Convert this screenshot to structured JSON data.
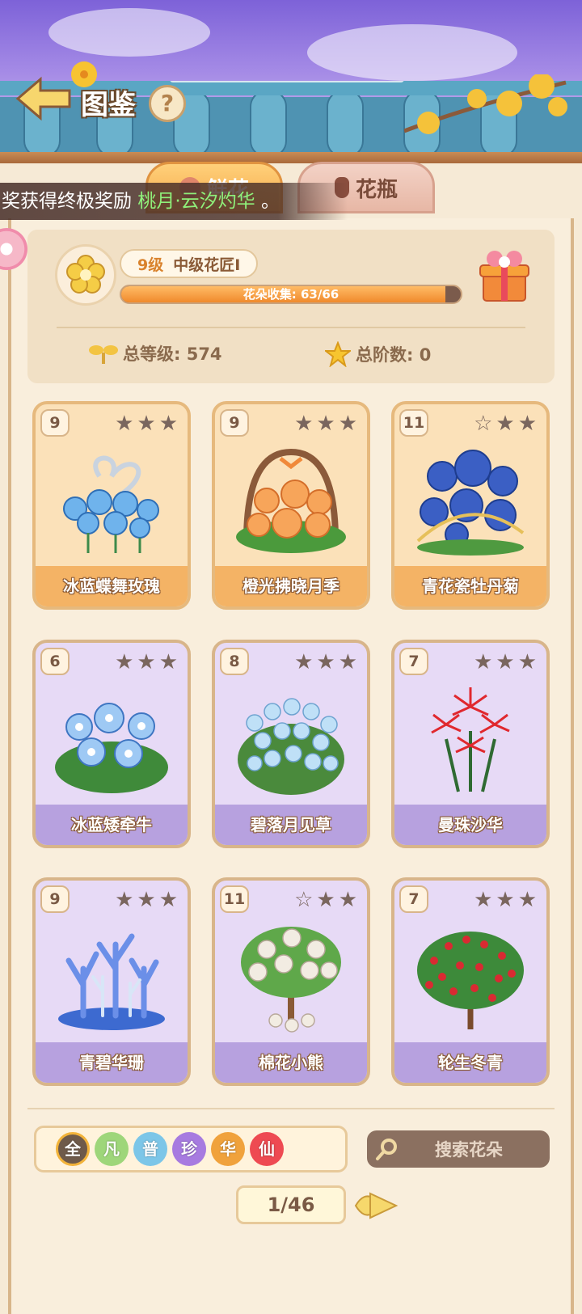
{
  "header": {
    "title": "图鉴",
    "help_label": "?"
  },
  "tabs": [
    {
      "label": "鲜花",
      "active": true
    },
    {
      "label": "花瓶",
      "active": false
    }
  ],
  "marquee": {
    "prefix": "奖获得终极奖励",
    "highlight": "桃月·云汐灼华",
    "suffix": "。"
  },
  "profile": {
    "level": "9级",
    "rank_title": "中级花匠I",
    "collection_label": "花朵收集: 63/66",
    "collection_progress": 0.9545,
    "total_level_label": "总等级: 574",
    "total_rank_label": "总阶数: 0"
  },
  "cards": [
    {
      "level": "9",
      "name": "冰蓝蝶舞玫瑰",
      "stars_filled": 0,
      "style": "orange",
      "art": "blue-rose"
    },
    {
      "level": "9",
      "name": "橙光拂晓月季",
      "stars_filled": 0,
      "style": "orange",
      "art": "orange-rose"
    },
    {
      "level": "11",
      "name": "青花瓷牡丹菊",
      "stars_filled": 1,
      "style": "orange",
      "art": "blue-chrysanthemum"
    },
    {
      "level": "6",
      "name": "冰蓝矮牵牛",
      "stars_filled": 0,
      "style": "purple",
      "art": "blue-petunia"
    },
    {
      "level": "8",
      "name": "碧落月见草",
      "stars_filled": 0,
      "style": "purple",
      "art": "blue-primrose"
    },
    {
      "level": "7",
      "name": "曼珠沙华",
      "stars_filled": 0,
      "style": "purple",
      "art": "red-spider-lily"
    },
    {
      "level": "9",
      "name": "青碧华珊",
      "stars_filled": 0,
      "style": "purple",
      "art": "blue-coral"
    },
    {
      "level": "11",
      "name": "棉花小熊",
      "stars_filled": 1,
      "style": "purple",
      "art": "cotton-bear-tree"
    },
    {
      "level": "7",
      "name": "轮生冬青",
      "stars_filled": 0,
      "style": "purple",
      "art": "red-holly"
    }
  ],
  "filters": [
    {
      "label": "全",
      "color": "#6e5a4a",
      "active": true
    },
    {
      "label": "凡",
      "color": "#9ed67a",
      "active": false
    },
    {
      "label": "普",
      "color": "#7cc6e8",
      "active": false
    },
    {
      "label": "珍",
      "color": "#a77be0",
      "active": false
    },
    {
      "label": "华",
      "color": "#f0a23c",
      "active": false
    },
    {
      "label": "仙",
      "color": "#ee4a52",
      "active": false
    }
  ],
  "search": {
    "label": "搜索花朵"
  },
  "pager": {
    "label": "1/46"
  },
  "colors": {
    "accent_orange": "#f4b365",
    "accent_purple": "#b7a1df",
    "marquee_highlight": "#8ff07a"
  }
}
